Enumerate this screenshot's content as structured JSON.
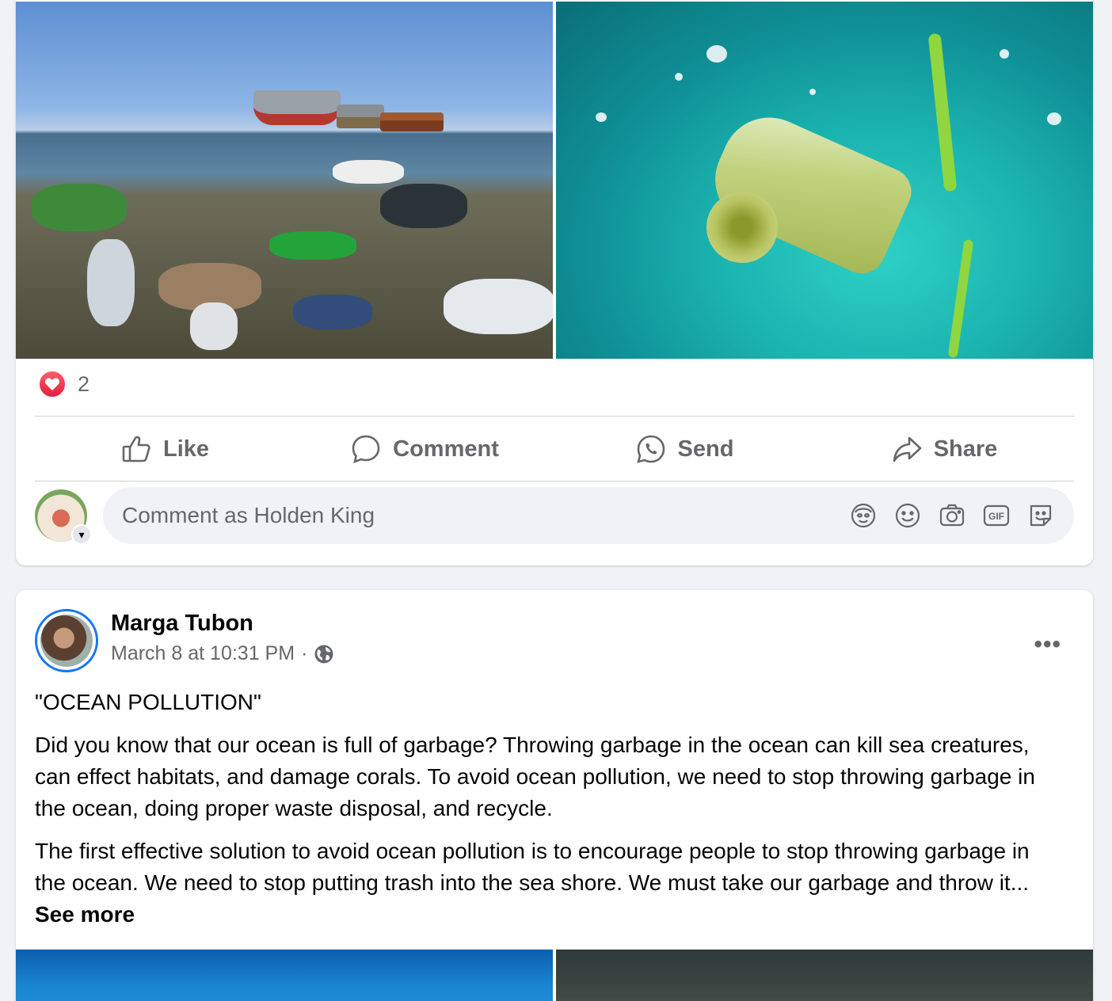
{
  "post1": {
    "reaction_count": "2",
    "actions": {
      "like": "Like",
      "comment": "Comment",
      "send": "Send",
      "share": "Share"
    },
    "comment_placeholder": "Comment as Holden King",
    "comment_tools": [
      "avatar-sticker-icon",
      "emoji-icon",
      "camera-icon",
      "gif-icon",
      "sticker-icon"
    ]
  },
  "post2": {
    "author": "Marga Tubon",
    "timestamp": "March 8 at 10:31 PM",
    "separator": "·",
    "title_line": "\"OCEAN POLLUTION\"",
    "paragraph1": "Did you know that our ocean is full of garbage? Throwing garbage in the ocean can kill sea creatures, can effect habitats, and damage corals. To avoid ocean pollution, we need to stop throwing garbage in the ocean, doing proper waste disposal, and recycle.",
    "paragraph2": "The first effective solution to avoid ocean pollution is to encourage people to stop throwing garbage in the ocean. We need to stop putting trash into the sea shore. We must take our garbage and throw it...",
    "see_more": "See more",
    "more_menu": "•••"
  },
  "colors": {
    "reaction_heart": "#e41e3f",
    "action_text": "#65676b",
    "story_ring": "#1877f2",
    "page_bg": "#f0f2f5"
  }
}
